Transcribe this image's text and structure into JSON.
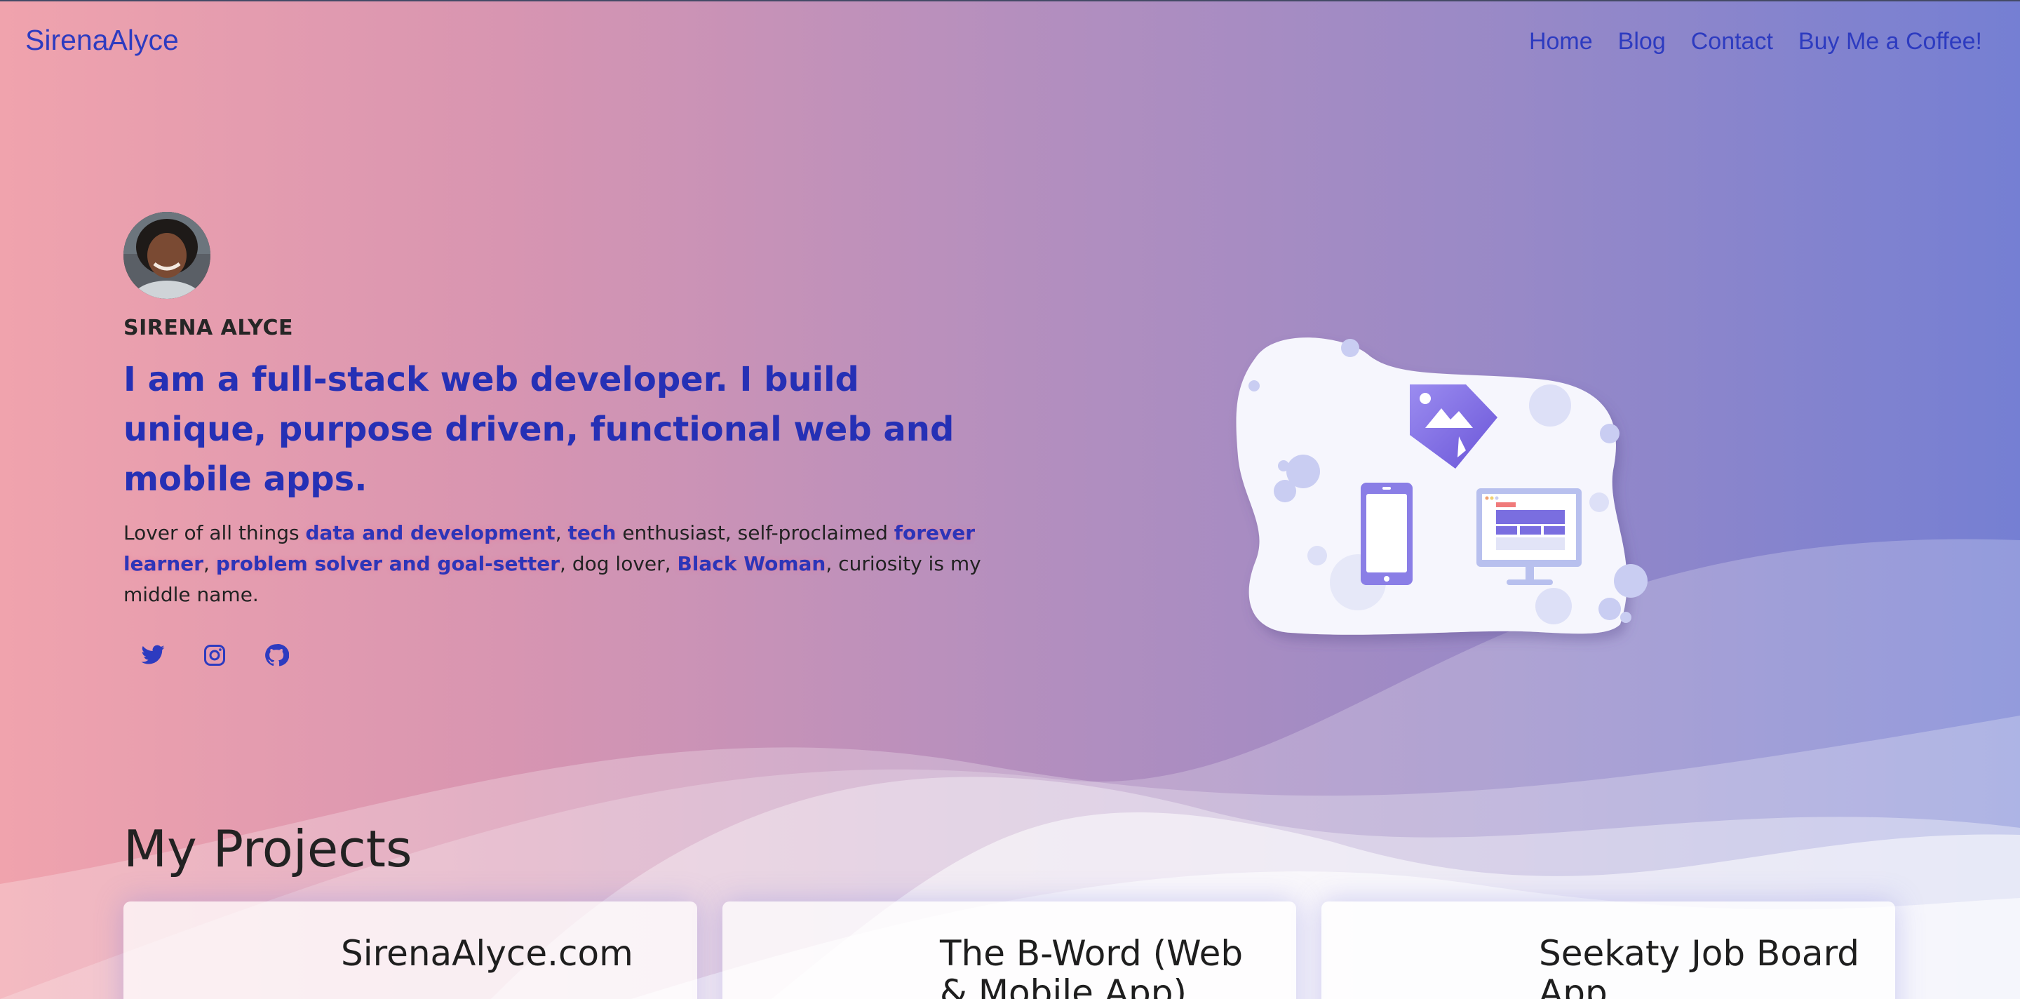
{
  "nav": {
    "brand": "SirenaAlyce",
    "links": [
      "Home",
      "Blog",
      "Contact",
      "Buy Me a Coffee!"
    ]
  },
  "intro": {
    "name": "SIRENA ALYCE",
    "headline": "I am a full-stack web developer. I build unique, purpose driven, functional web and mobile apps.",
    "bio": {
      "p1": "Lover of all things ",
      "h1": "data and development",
      "p2": ", ",
      "h2": "tech",
      "p3": " enthusiast, self-proclaimed ",
      "h3": "forever learner",
      "p4": ", ",
      "h4": "problem solver and goal-setter",
      "p5": ", dog lover, ",
      "h5": "Black Woman",
      "p6": ", curiosity is my middle name."
    },
    "socials": [
      "twitter-icon",
      "instagram-icon",
      "github-icon"
    ]
  },
  "projects": {
    "title": "My Projects",
    "cards": [
      "SirenaAlyce.com",
      "The B-Word (Web & Mobile App)",
      "Seekaty Job Board App"
    ]
  },
  "colors": {
    "gradient_start": "#f0a3ad",
    "gradient_end": "#757fd3",
    "accent": "#2d3bc0",
    "heading": "#2530b5"
  }
}
